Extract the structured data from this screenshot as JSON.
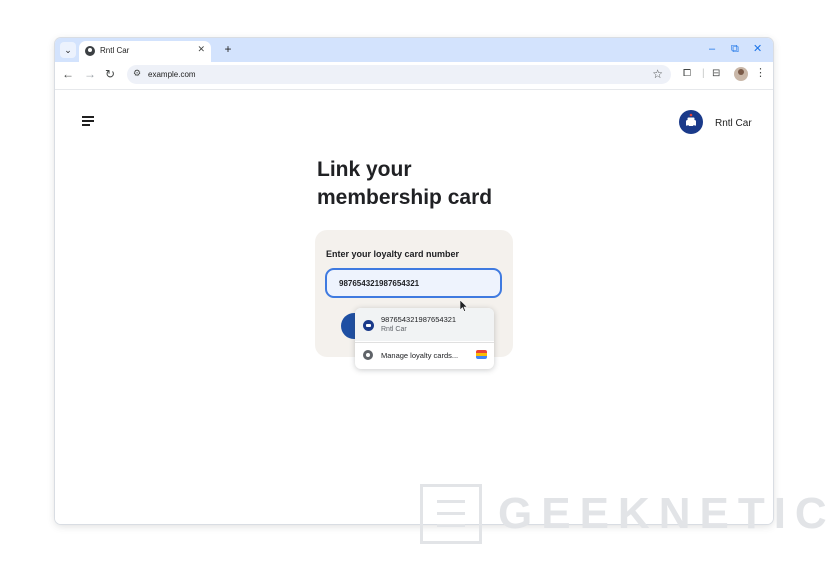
{
  "browser": {
    "tab_title": "Rntl Car",
    "tab_close": "✕",
    "new_tab": "+",
    "url": "example.com",
    "controls": {
      "minimize": "–",
      "restore": "⧉",
      "close": "✕"
    }
  },
  "page": {
    "brand_name": "Rntl Car",
    "title_line1": "Link your",
    "title_line2": "membership card"
  },
  "card": {
    "label": "Enter your loyalty card number",
    "input_value": "987654321987654321"
  },
  "autofill": {
    "suggestion_number": "987654321987654321",
    "suggestion_source": "Rntl Car",
    "manage_label": "Manage loyalty cards..."
  },
  "watermark": "GEEKNETIC",
  "colors": {
    "accent": "#1a73e8",
    "tabstrip": "#d3e3fd",
    "brand": "#1a3a8a",
    "card_bg": "#f4f1ed"
  }
}
